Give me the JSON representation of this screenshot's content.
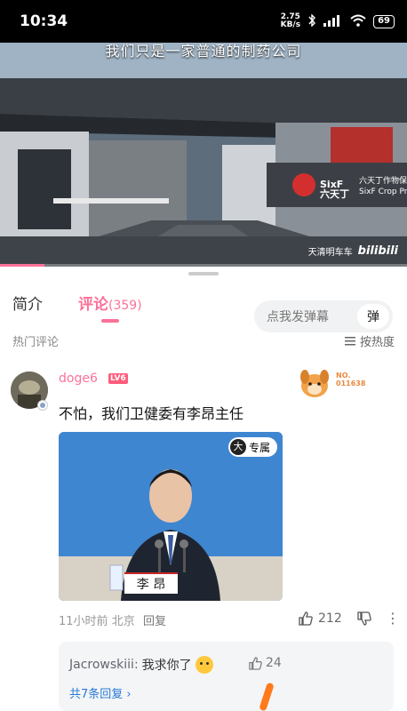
{
  "status_bar": {
    "time": "10:34",
    "net_speed_value": "2.75",
    "net_speed_unit": "KB/s",
    "battery": "69"
  },
  "video": {
    "subtitle": "我们只是一家普通的制药公司",
    "sign_brand": "SixF",
    "sign_brand_cn": "六天丁",
    "sign_text": "六天丁作物保",
    "sign_text2": "SixF Crop Pro",
    "watermark_channel": "天清明车车",
    "watermark_logo": "bilibili",
    "progress": 0.11
  },
  "tabs": {
    "intro": "简介",
    "comments": "评论",
    "comments_count": "(359)"
  },
  "danmaku": {
    "placeholder": "点我发弹幕",
    "button": "弹"
  },
  "comments_header": {
    "hot_label": "热门评论",
    "sort_label": "按热度"
  },
  "comment": {
    "username": "doge6",
    "level": "LV6",
    "decor_no_label": "NO.",
    "decor_number": "011638",
    "text": "不怕，我们卫健委有李昂主任",
    "image_badge_char": "大",
    "image_badge_text": "专属",
    "image_name_plate": "李 昂",
    "time": "11小时前",
    "location": "北京",
    "reply_label": "回复",
    "likes": "212"
  },
  "subreplies": {
    "user": "Jacrowskiii:",
    "text": "我求你了",
    "likes": "24",
    "total": "共7条回复 ›"
  },
  "colors": {
    "accent": "#fb7299",
    "link": "#2a7ad6"
  }
}
